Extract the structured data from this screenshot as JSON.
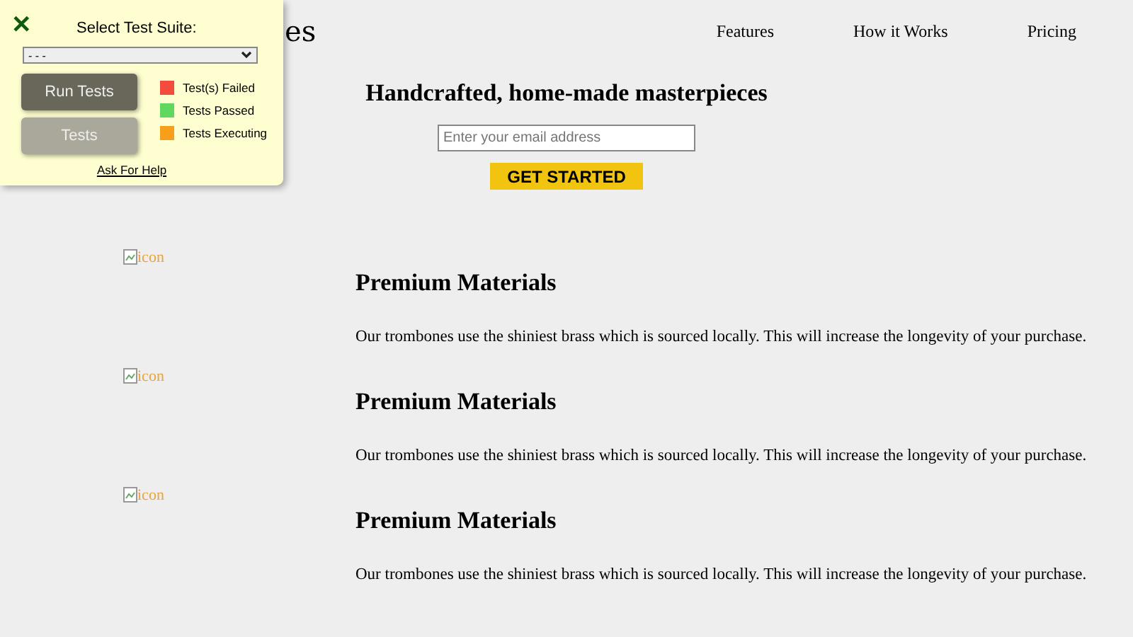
{
  "header": {
    "logo": "es",
    "nav": [
      "Features",
      "How it Works",
      "Pricing"
    ]
  },
  "hero": {
    "title": "Handcrafted, home-made masterpieces",
    "email": {
      "placeholder": "Enter your email address"
    },
    "button": "GET STARTED"
  },
  "features": [
    {
      "image_alt": "icon",
      "title": "Premium Materials",
      "text": "Our trombones use the shiniest brass which is sourced locally. This will increase the longevity of your purchase."
    },
    {
      "image_alt": "icon",
      "title": "Premium Materials",
      "text": "Our trombones use the shiniest brass which is sourced locally. This will increase the longevity of your purchase."
    },
    {
      "image_alt": "icon",
      "title": "Premium Materials",
      "text": "Our trombones use the shiniest brass which is sourced locally. This will increase the longevity of your purchase."
    }
  ],
  "test_panel": {
    "close": "✕",
    "label": "Select Test Suite:",
    "suite": "- - -",
    "buttons": [
      {
        "label": "Run Tests",
        "kind": "primary"
      },
      {
        "label": "Tests",
        "kind": "secondary"
      }
    ],
    "legend": [
      {
        "label": "Test(s) Failed",
        "color": "#f44b3e"
      },
      {
        "label": "Tests Passed",
        "color": "#5ed85e"
      },
      {
        "label": "Tests Executing",
        "color": "#f79e1b"
      }
    ],
    "help_link": "Ask For Help"
  }
}
